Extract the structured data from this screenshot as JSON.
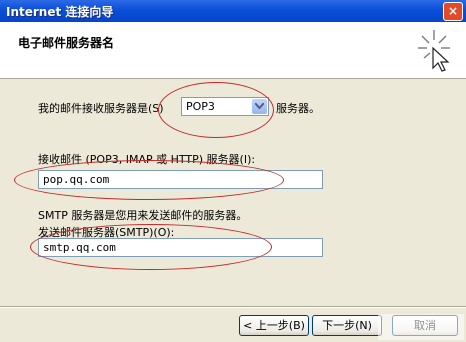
{
  "window": {
    "title": "Internet 连接向导",
    "close_label": "×"
  },
  "header": {
    "title": "电子邮件服务器名"
  },
  "incoming_type": {
    "label": "我的邮件接收服务器是(S)",
    "selected": "POP3",
    "suffix": "服务器。"
  },
  "incoming_server": {
    "label": "接收邮件 (POP3, IMAP 或 HTTP) 服务器(I):",
    "value": "pop.qq.com"
  },
  "smtp_note": {
    "text": "SMTP 服务器是您用来发送邮件的服务器。"
  },
  "outgoing_server": {
    "label": "发送邮件服务器(SMTP)(O):",
    "value": "smtp.qq.com"
  },
  "buttons": {
    "back": "< 上一步(B)",
    "next": "下一步(N)",
    "cancel": "取消"
  }
}
